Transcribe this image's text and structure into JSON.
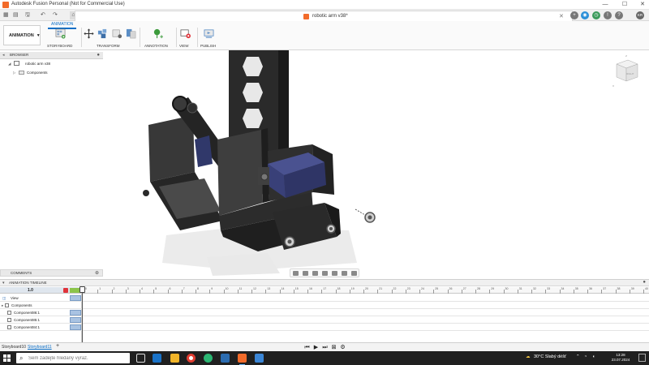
{
  "window": {
    "title": "Autodesk Fusion Personal (Not for Commercial Use)",
    "min_glyph": "—",
    "max_glyph": "☐",
    "close_glyph": "✕"
  },
  "quick_access": {
    "grid_glyph": "▦",
    "file_glyph": "▤",
    "save_glyph": "🖫",
    "undo_glyph": "↶",
    "redo_glyph": "↷",
    "home_glyph": "⌂"
  },
  "document": {
    "title": "robotic arm v38*",
    "close_glyph": "✕",
    "user_initials": "KR"
  },
  "ribbon": {
    "workspace": "ANIMATION",
    "tab": "ANIMATION",
    "groups": {
      "storyboard": "STORYBOARD",
      "transform": "TRANSFORM",
      "annotation": "ANNOTATION",
      "view": "VIEW",
      "publish": "PUBLISH"
    }
  },
  "browser": {
    "label": "BROWSER",
    "root": "robotic arm v38",
    "child": "Components"
  },
  "viewcube": {
    "label": "RIGHT"
  },
  "comments": {
    "label": "COMMENTS"
  },
  "timeline": {
    "label": "ANIMATION TIMELINE",
    "zoom": "1.0",
    "ruler_ticks": [
      "0",
      "1",
      "2",
      "3",
      "4",
      "5",
      "6",
      "7",
      "8",
      "9",
      "10",
      "11",
      "12",
      "13",
      "14",
      "15",
      "16",
      "17",
      "18",
      "19",
      "20",
      "21",
      "22",
      "23",
      "24",
      "25",
      "26",
      "27",
      "28",
      "29",
      "30",
      "31",
      "32",
      "33",
      "34",
      "35",
      "36",
      "37",
      "38",
      "39",
      "40"
    ],
    "rows": {
      "view": "View",
      "components": "Components",
      "c1": "Component86:1",
      "c2": "Component85:1",
      "c3": "Component84:1"
    }
  },
  "storyboard_bar": {
    "tab1": "Storyboard10",
    "tab2": "Storyboard11",
    "add": "+"
  },
  "taskbar": {
    "search_placeholder": "Sem zadejte hledaný výraz.",
    "weather": "30°C  Slabý déšť",
    "time": "13:28",
    "date": "23.07.2024"
  },
  "colors": {
    "accent": "#0a6ec7",
    "brand": "#f26b2a",
    "record": "#e0333a",
    "playhead_range": "#8cc44a",
    "servo": "#33396b",
    "frame": "#2d2d2d"
  }
}
